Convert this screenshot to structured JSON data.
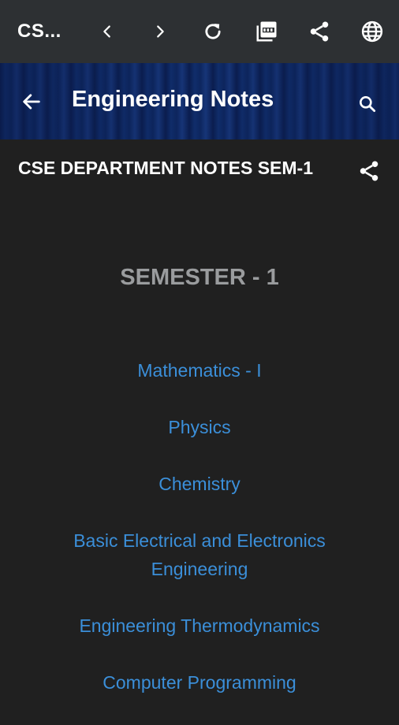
{
  "browser_bar": {
    "title": "CS...",
    "icons": [
      "chevron-left-icon",
      "chevron-right-icon",
      "reload-icon",
      "pdf-icon",
      "share-icon",
      "globe-icon"
    ],
    "background": "#2d3033"
  },
  "app_header": {
    "title": "Engineering Notes",
    "back_icon": "arrow-left-icon",
    "search_icon": "search-icon"
  },
  "post": {
    "title": "CSE DEPARTMENT NOTES SEM-1",
    "share_icon": "share-icon"
  },
  "content": {
    "heading": "SEMESTER - 1",
    "heading_color": "#9a9c9e",
    "link_color": "#3b8fd9",
    "subjects": [
      "Mathematics - I",
      "Physics",
      "Chemistry",
      "Basic Electrical and Electronics Engineering",
      "Engineering Thermodynamics",
      "Computer Programming"
    ]
  },
  "colors": {
    "background": "#202020"
  }
}
